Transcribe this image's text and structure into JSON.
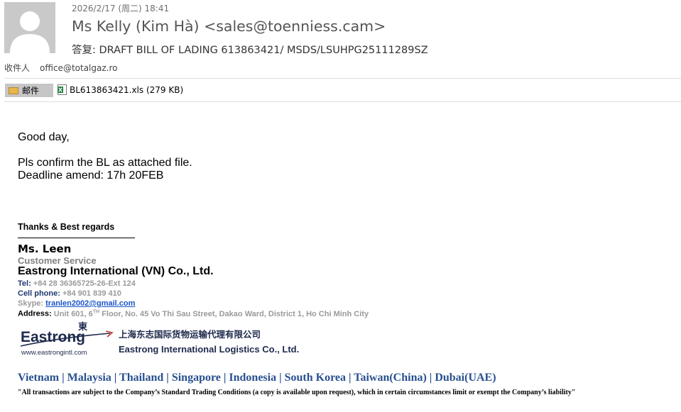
{
  "header": {
    "date": "2026/2/17 (周二) 18:41",
    "sender": "Ms Kelly (Kim Hà) <sales@toenniess.cam>",
    "subject": "答复: DRAFT BILL OF LADING 613863421/ MSDS/LSUHPG25111289SZ",
    "to_label": "收件人",
    "to_value": "office@totalgaz.ro"
  },
  "attachments": {
    "mail_button": "邮件",
    "file_name": "BL613863421.xls (279 KB)"
  },
  "body": {
    "greeting": "Good day,",
    "line1": "Pls confirm the BL as attached file.",
    "line2": "Deadline amend: 17h 20FEB"
  },
  "signature": {
    "thanks": "Thanks & Best regards",
    "name": "Ms. Leen",
    "role": "Customer Service",
    "company": "Eastrong International (VN) Co., Ltd.",
    "tel_label": "Tel:",
    "tel_value": "+84  28 36365725-26-Ext 124",
    "cell_label": "Cell phone:",
    "cell_value": "+84 901 839 410",
    "skype_label": "Skype:",
    "skype_value": "tranlen2002@gmail.com",
    "address_label": "Address:",
    "address_pre": "Unit 601, 6",
    "address_sup": "TH",
    "address_post": " Floor, No. 45 Vo Thi Sau Street, Dakao Ward, District 1, Ho Chi Minh City",
    "logo_word": "Eastrong",
    "logo_cn_glyph": "東",
    "logo_url": "www.eastrongintl.com",
    "logo_cn_name": "上海东志国际货物运输代理有限公司",
    "logo_en_name": "Eastrong International Logistics Co., Ltd.",
    "countries": "Vietnam | Malaysia | Thailand | Singapore | Indonesia | South Korea | Taiwan(China) | Dubai(UAE)",
    "disclaimer": "\"All transactions are subject to the Company’s Standard Trading Conditions (a copy is available upon request), which in certain circumstances limit or exempt the Company’s liability\""
  },
  "colors": {
    "link": "#1a55c8",
    "countries": "#27508f",
    "logo_navy": "#1e2a4c"
  }
}
